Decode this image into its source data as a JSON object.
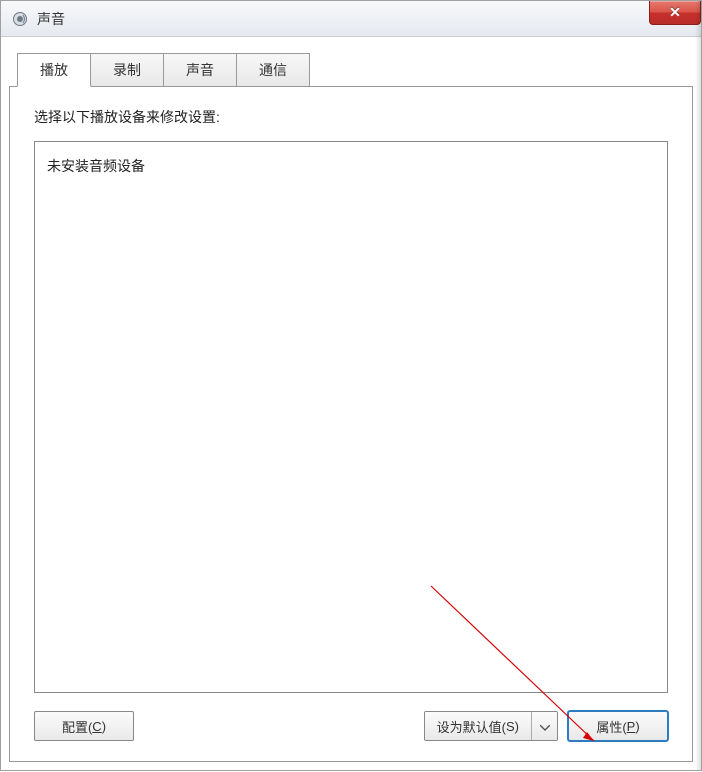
{
  "window": {
    "title": "声音"
  },
  "tabs": [
    {
      "label": "播放"
    },
    {
      "label": "录制"
    },
    {
      "label": "声音"
    },
    {
      "label": "通信"
    }
  ],
  "panel": {
    "instruction": "选择以下播放设备来修改设置:",
    "empty_message": "未安装音频设备"
  },
  "buttons": {
    "configure": {
      "prefix": "配置(",
      "accel": "C",
      "suffix": ")"
    },
    "set_default": {
      "prefix": "设为默认值(",
      "accel": "S",
      "suffix": ")"
    },
    "properties": {
      "prefix": "属性(",
      "accel": "P",
      "suffix": ")"
    }
  }
}
